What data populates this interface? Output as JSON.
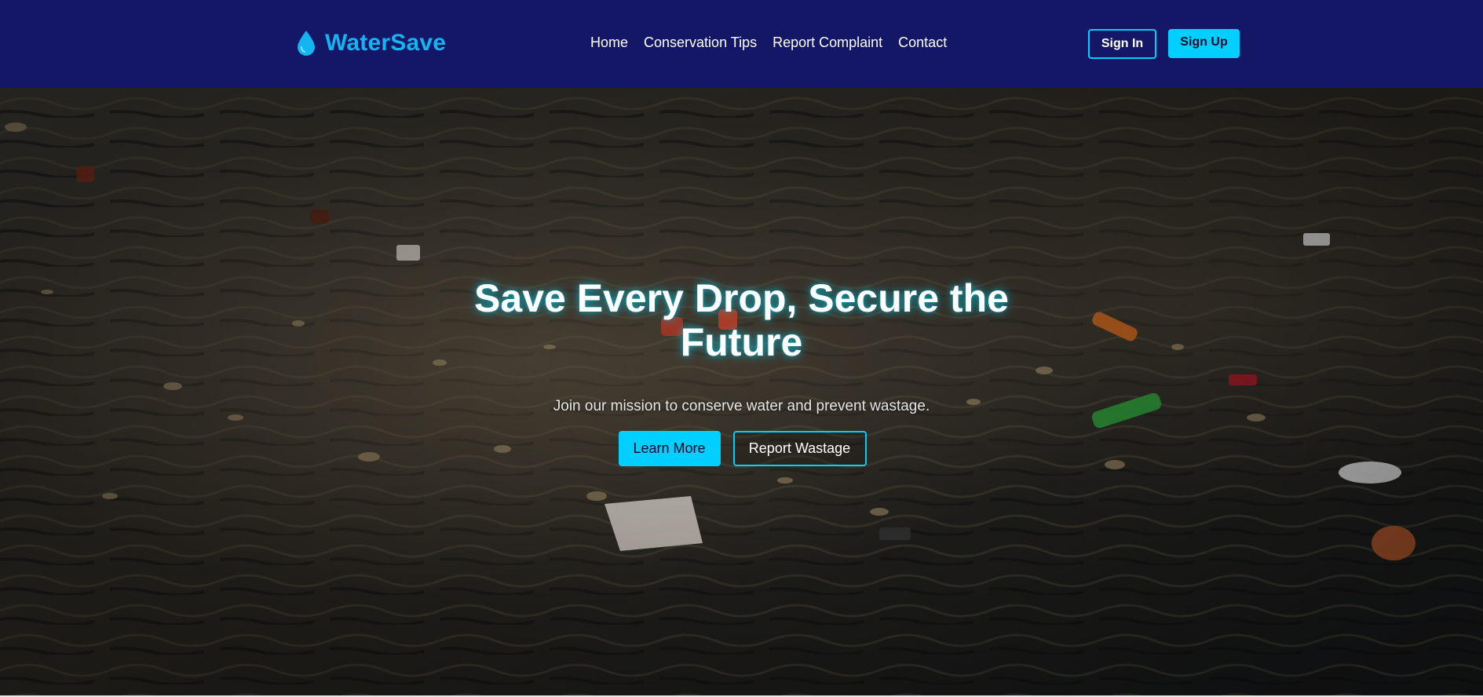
{
  "header": {
    "brand": {
      "icon": "water-drop-icon",
      "name": "WaterSave"
    },
    "nav": [
      {
        "label": "Home"
      },
      {
        "label": "Conservation Tips"
      },
      {
        "label": "Report Complaint"
      },
      {
        "label": "Contact"
      }
    ],
    "auth": {
      "sign_in_label": "Sign In",
      "sign_up_label": "Sign Up"
    }
  },
  "hero": {
    "background": "polluted-water-with-floating-litter",
    "title": "Save Every Drop, Secure the Future",
    "subtitle": "Join our mission to conserve water and prevent wastage.",
    "primary_button": "Learn More",
    "secondary_button": "Report Wastage"
  },
  "colors": {
    "navbar_bg": "#131765",
    "brand": "#12b4f2",
    "accent": "#00cfff",
    "text": "#ffffff"
  }
}
